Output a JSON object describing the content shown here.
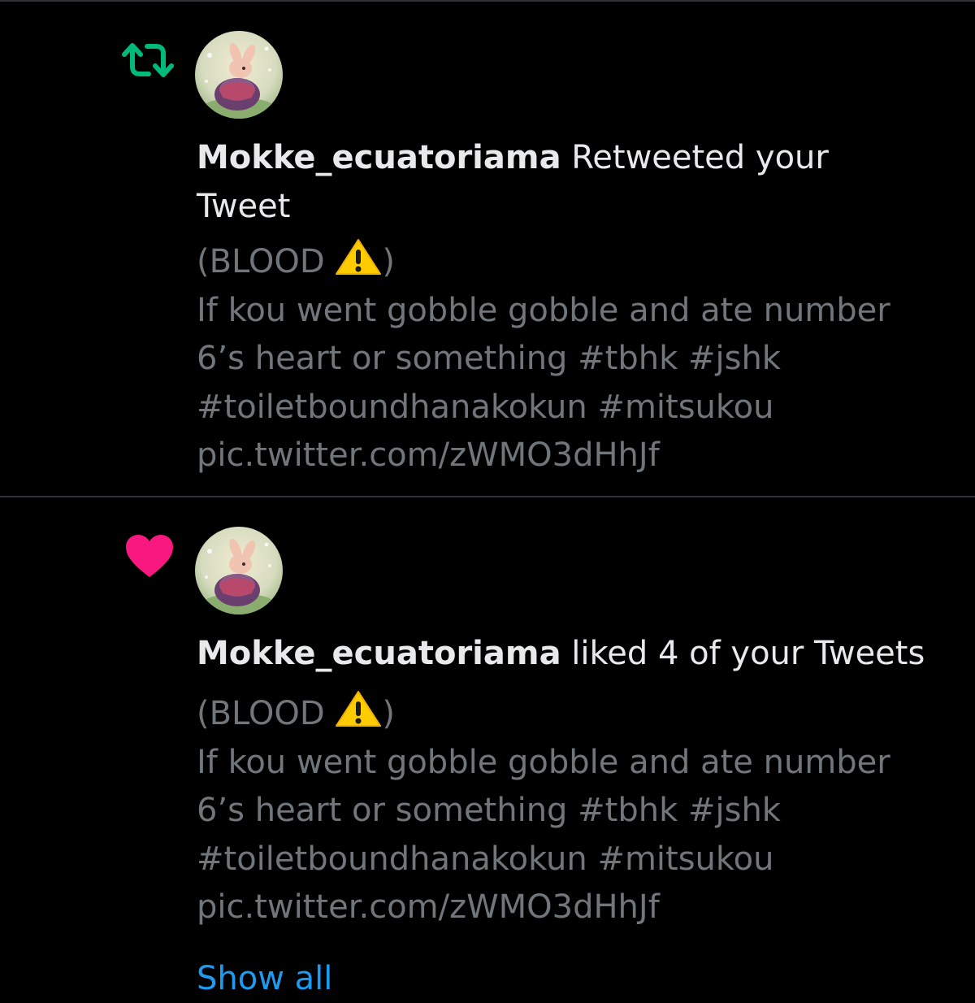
{
  "colors": {
    "background": "#000000",
    "divider": "#2f3336",
    "primary_text": "#e7e9ea",
    "secondary_text": "#71767b",
    "retweet_green": "#00ba7c",
    "like_pink": "#f91880",
    "link_blue": "#1d9bf0",
    "warning_yellow": "#ffcc00"
  },
  "notifications": [
    {
      "type_icon": "retweet-icon",
      "avatar_icon": "rabbit-avatar",
      "username": "Mokke_ecuatoriama",
      "action_line1": " Retweeted your",
      "action_line2": "Tweet",
      "tweet": {
        "line1_prefix": "(BLOOD ",
        "line1_emoji": "warning-emoji",
        "line1_suffix": ")",
        "line2": "If kou went gobble gobble and ate number",
        "line3": "6’s heart or something #tbhk #jshk",
        "line4": "#toiletboundhanakokun #mitsukou",
        "line5": "pic.twitter.com/zWMO3dHhJf"
      }
    },
    {
      "type_icon": "heart-icon",
      "avatar_icon": "rabbit-avatar",
      "username": "Mokke_ecuatoriama",
      "action_line1": " liked 4 of your Tweets",
      "tweet": {
        "line1_prefix": "(BLOOD ",
        "line1_emoji": "warning-emoji",
        "line1_suffix": ")",
        "line2": "If kou went gobble gobble and ate number",
        "line3": "6’s heart or something #tbhk #jshk",
        "line4": "#toiletboundhanakokun #mitsukou",
        "line5": "pic.twitter.com/zWMO3dHhJf"
      },
      "show_all_label": "Show all"
    }
  ]
}
